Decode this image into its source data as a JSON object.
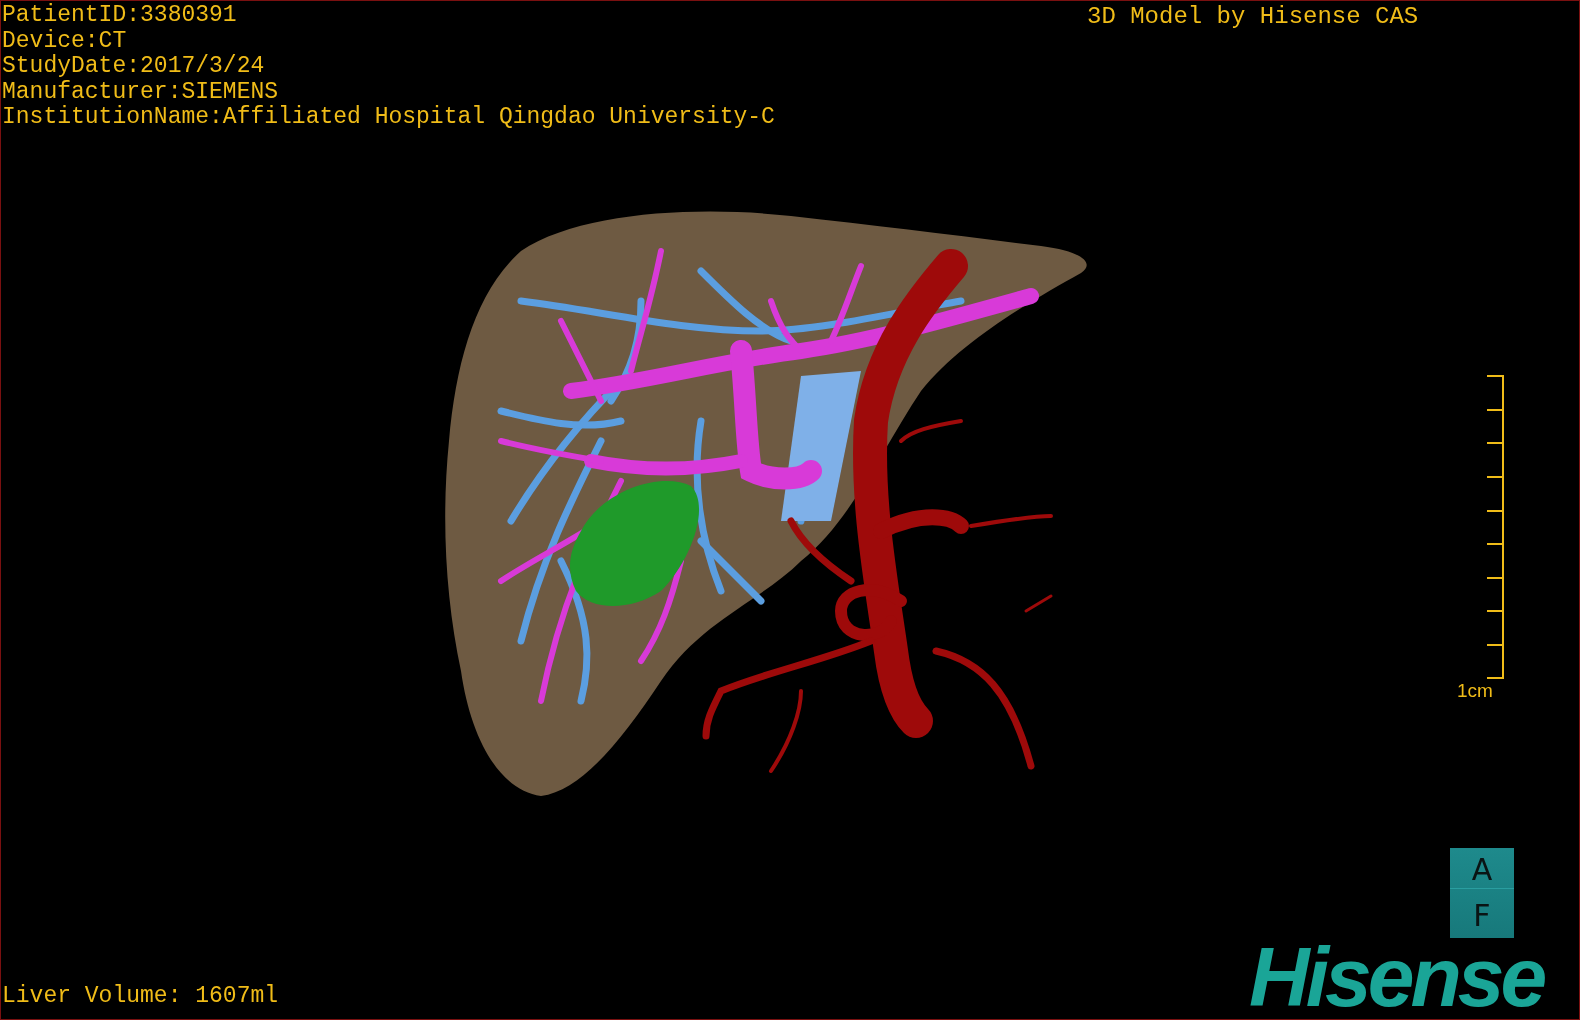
{
  "study_info": [
    "PatientID:3380391",
    "Device:CT",
    "StudyDate:2017/3/24",
    "Manufacturer:SIEMENS",
    "InstitutionName:Affiliated Hospital Qingdao University-C"
  ],
  "model_title": "3D Model by Hisense CAS",
  "scale_bar": {
    "label": "1cm"
  },
  "orientation_cube": {
    "top": "A",
    "bottom": "F"
  },
  "logo": "Hisense",
  "liver_volume": "Liver Volume: 1607ml"
}
